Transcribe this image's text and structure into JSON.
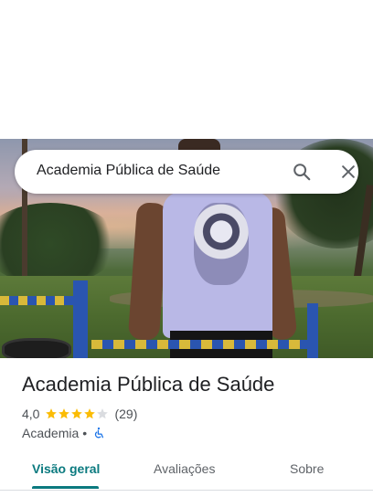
{
  "search": {
    "query": "Academia Pública de Saúde",
    "search_icon": "search-icon",
    "close_icon": "close-icon"
  },
  "hero_photo": {
    "description_icon": "place-photo"
  },
  "place": {
    "name": "Academia Pública de Saúde",
    "rating": "4,0",
    "rating_value": 4.0,
    "stars_max": 5,
    "reviews": "(29)",
    "category": "Academia",
    "separator": "•",
    "accessibility_icon": "wheelchair-icon",
    "colors": {
      "star_filled": "#fbbc04",
      "star_empty": "#dadce0",
      "accessibility": "#1a73e8"
    }
  },
  "tabs": [
    {
      "label": "Visão geral",
      "selected": true
    },
    {
      "label": "Avaliações",
      "selected": false
    },
    {
      "label": "Sobre",
      "selected": false
    }
  ],
  "colors": {
    "accent": "#0b7a7f"
  }
}
